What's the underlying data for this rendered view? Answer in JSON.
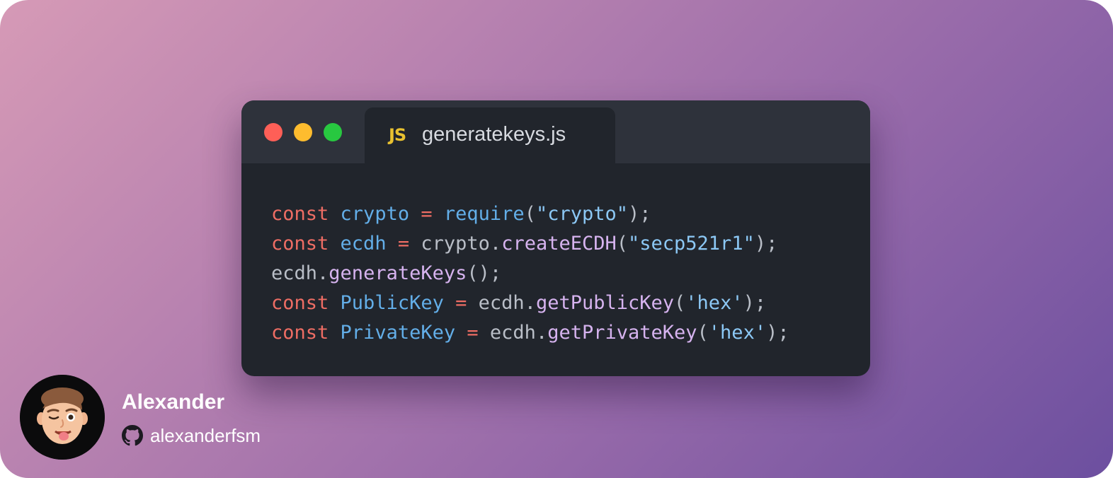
{
  "window": {
    "controls": [
      "close",
      "minimize",
      "zoom"
    ],
    "tab": {
      "icon_text": "JS",
      "filename": "generatekeys.js"
    }
  },
  "code": {
    "lines": [
      [
        {
          "t": "const",
          "k": "kw"
        },
        {
          "t": " ",
          "k": "plain"
        },
        {
          "t": "crypto",
          "k": "var"
        },
        {
          "t": " ",
          "k": "plain"
        },
        {
          "t": "=",
          "k": "op"
        },
        {
          "t": " ",
          "k": "plain"
        },
        {
          "t": "require",
          "k": "var"
        },
        {
          "t": "(",
          "k": "punc"
        },
        {
          "t": "\"crypto\"",
          "k": "str"
        },
        {
          "t": ");",
          "k": "punc"
        }
      ],
      [
        {
          "t": "const",
          "k": "kw"
        },
        {
          "t": " ",
          "k": "plain"
        },
        {
          "t": "ecdh",
          "k": "var"
        },
        {
          "t": " ",
          "k": "plain"
        },
        {
          "t": "=",
          "k": "op"
        },
        {
          "t": " ",
          "k": "plain"
        },
        {
          "t": "crypto",
          "k": "plain"
        },
        {
          "t": ".",
          "k": "punc"
        },
        {
          "t": "createECDH",
          "k": "fn"
        },
        {
          "t": "(",
          "k": "punc"
        },
        {
          "t": "\"secp521r1\"",
          "k": "str"
        },
        {
          "t": ");",
          "k": "punc"
        }
      ],
      [
        {
          "t": "ecdh",
          "k": "plain"
        },
        {
          "t": ".",
          "k": "punc"
        },
        {
          "t": "generateKeys",
          "k": "fn"
        },
        {
          "t": "();",
          "k": "punc"
        }
      ],
      [
        {
          "t": "const",
          "k": "kw"
        },
        {
          "t": " ",
          "k": "plain"
        },
        {
          "t": "PublicKey",
          "k": "var"
        },
        {
          "t": " ",
          "k": "plain"
        },
        {
          "t": "=",
          "k": "op"
        },
        {
          "t": " ",
          "k": "plain"
        },
        {
          "t": "ecdh",
          "k": "plain"
        },
        {
          "t": ".",
          "k": "punc"
        },
        {
          "t": "getPublicKey",
          "k": "fn"
        },
        {
          "t": "(",
          "k": "punc"
        },
        {
          "t": "'hex'",
          "k": "str"
        },
        {
          "t": ");",
          "k": "punc"
        }
      ],
      [
        {
          "t": "const",
          "k": "kw"
        },
        {
          "t": " ",
          "k": "plain"
        },
        {
          "t": "PrivateKey",
          "k": "var"
        },
        {
          "t": " ",
          "k": "plain"
        },
        {
          "t": "=",
          "k": "op"
        },
        {
          "t": " ",
          "k": "plain"
        },
        {
          "t": "ecdh",
          "k": "plain"
        },
        {
          "t": ".",
          "k": "punc"
        },
        {
          "t": "getPrivateKey",
          "k": "fn"
        },
        {
          "t": "(",
          "k": "punc"
        },
        {
          "t": "'hex'",
          "k": "str"
        },
        {
          "t": ");",
          "k": "punc"
        }
      ]
    ]
  },
  "author": {
    "name": "Alexander",
    "handle": "alexanderfsm",
    "handle_icon": "github-icon",
    "avatar": "memoji-avatar"
  },
  "colors": {
    "background_gradient": [
      "#d69ab6",
      "#9468a9",
      "#6c4f9f"
    ],
    "window_bg": "#21252c",
    "titlebar_bg": "#2e323b",
    "close": "#fe5f57",
    "minimize": "#febc2e",
    "zoom": "#28c840",
    "js_icon": "#e8c130"
  }
}
